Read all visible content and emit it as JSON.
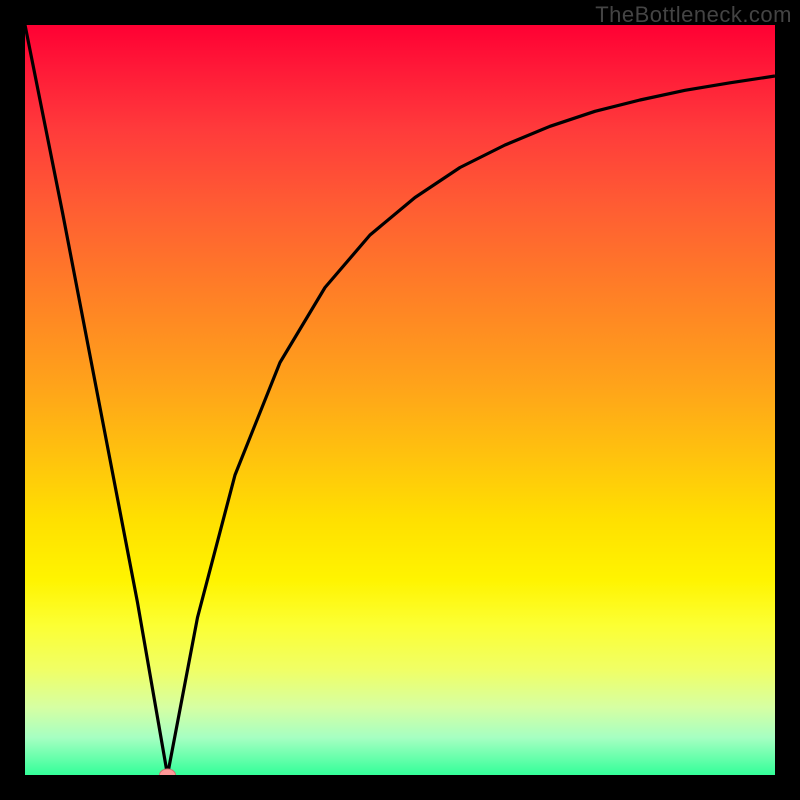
{
  "watermark": "TheBottleneck.com",
  "chart_data": {
    "type": "line",
    "title": "",
    "xlabel": "",
    "ylabel": "",
    "xlim": [
      0,
      100
    ],
    "ylim": [
      0,
      100
    ],
    "background_gradient": "Bottleneck percentage (red high, green low)",
    "marker": {
      "x": 19,
      "y": 0,
      "color": "#ff9999"
    },
    "series": [
      {
        "name": "bottleneck-curve",
        "x": [
          0,
          5,
          10,
          15,
          19,
          23,
          28,
          34,
          40,
          46,
          52,
          58,
          64,
          70,
          76,
          82,
          88,
          94,
          100
        ],
        "values": [
          100,
          75,
          49,
          23,
          0,
          21,
          40,
          55,
          65,
          72,
          77,
          81,
          84,
          86.5,
          88.5,
          90,
          91.3,
          92.3,
          93.2
        ]
      }
    ]
  }
}
